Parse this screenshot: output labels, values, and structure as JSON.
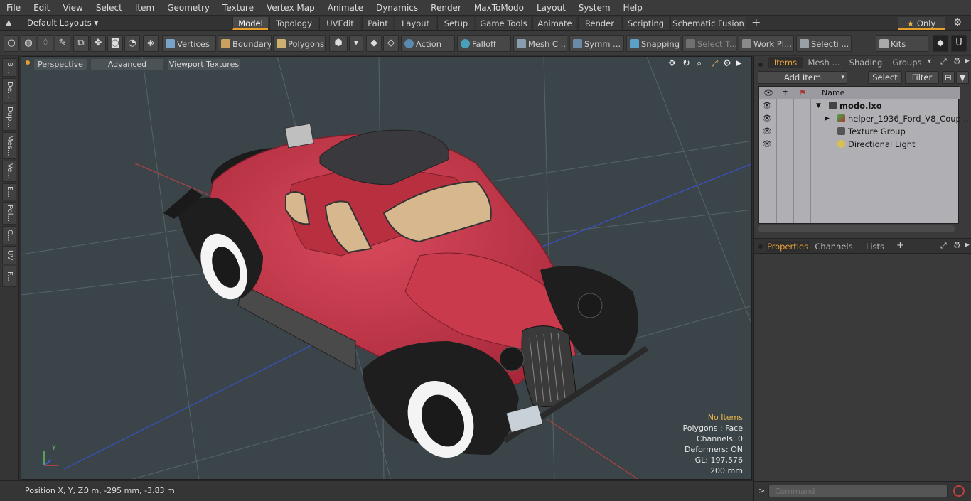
{
  "menu": [
    "File",
    "Edit",
    "View",
    "Select",
    "Item",
    "Geometry",
    "Texture",
    "Vertex Map",
    "Animate",
    "Dynamics",
    "Render",
    "MaxToModo",
    "Layout",
    "System",
    "Help"
  ],
  "layout_selector": "Default Layouts",
  "layout_tabs": [
    "Model",
    "Topology",
    "UVEdit",
    "Paint",
    "Layout",
    "Setup",
    "Game Tools",
    "Animate",
    "Render",
    "Scripting",
    "Schematic Fusion"
  ],
  "active_layout_tab": "Model",
  "only_label": "Only",
  "toolbar": {
    "vertices": "Vertices",
    "boundary": "Boundary",
    "polygons": "Polygons",
    "action": "Action",
    "falloff": "Falloff",
    "mesh": "Mesh C ...",
    "symm": "Symm ...",
    "snapping": "Snapping",
    "select_t": "Select T...",
    "work_pl": "Work Pl...",
    "selecti": "Selecti ...",
    "kits": "Kits"
  },
  "left_tabs": [
    "B...",
    "De...",
    "Dup...",
    "Mes...",
    "Ve...",
    "E...",
    "Pol...",
    "C...",
    "UV",
    "F..."
  ],
  "viewport": {
    "perspective": "Perspective",
    "advanced": "Advanced",
    "textures": "Viewport Textures",
    "stats": [
      "No Items",
      "Polygons : Face",
      "Channels: 0",
      "Deformers: ON",
      "GL: 197,576",
      "200 mm"
    ]
  },
  "status": {
    "position_label": "Position X, Y, Z:",
    "position_value": "0 m, -295 mm, -3.83 m"
  },
  "right_panel": {
    "tabs": [
      "Items",
      "Mesh ...",
      "Shading",
      "Groups"
    ],
    "active_tab": "Items",
    "add_item": "Add Item",
    "select": "Select",
    "filter": "Filter",
    "col_name": "Name",
    "items": [
      {
        "name": "modo.lxo",
        "bold": true
      },
      {
        "name": "helper_1936_Ford_V8_Coup ..."
      },
      {
        "name": "Texture Group"
      },
      {
        "name": "Directional Light"
      }
    ],
    "props_tabs": [
      "Properties",
      "Channels",
      "Lists"
    ],
    "active_props_tab": "Properties",
    "command_placeholder": "Command"
  },
  "colors": {
    "accent": "#e79f2a",
    "car_body": "#c8374a",
    "viewport_bg": "#3b4549"
  }
}
